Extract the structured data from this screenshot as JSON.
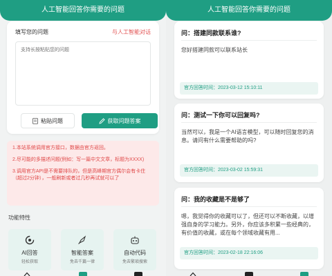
{
  "header": {
    "title": "人工智能回答你需要的问题"
  },
  "left": {
    "form": {
      "label": "填写您的问题",
      "link": "与人工智能对话",
      "placeholder": "支持长按粘贴您的问题",
      "paste_label": "粘贴问题",
      "get_answer_label": "获取问题答案"
    },
    "notices": [
      "1.本站系统调用官方接口，数据由官方返回。",
      "2.尽可能的多描述问题(例如：写一篇中文文章，标题为XXXX)",
      "3.调用官方API是不需要排队的，但是高峰期官方偶尔会有卡住（超过2分钟），一般刷新或者过几秒再试就可以了"
    ],
    "features": {
      "title": "功能特性",
      "items": [
        {
          "title": "AI回答",
          "subtitle": "轻松获取",
          "icon": "c-logo-icon"
        },
        {
          "title": "智能答案",
          "subtitle": "免去千篇一律",
          "icon": "rocket-icon"
        },
        {
          "title": "自动代码",
          "subtitle": "免去繁琐搜索",
          "icon": "robot-icon"
        }
      ]
    }
  },
  "right": {
    "answers": [
      {
        "question": "问：搭建同款联系谁?",
        "answer": "您好搭建同款可以联系站长",
        "time": "官方回答时间：2023-03-12 15:10:11"
      },
      {
        "question": "问：测试一下你可以回复吗?",
        "answer": "当然可以，我是一个AI语言模型，可以随时回复您的消息。请问有什么需要帮助的吗?",
        "time": "官方回答时间：2023-03-02 15:59:31"
      },
      {
        "question": "问：我的收藏是不是够了",
        "answer": "嗯，我觉得你的收藏可以了，但还可以不断收藏，以增强自身的学习能力。另外，你应该多积累一些经典的，有价值的收藏，或在每个领域收藏有用...",
        "time": "官方回答时间：2023-02-18 22:16:06"
      }
    ]
  },
  "colors": {
    "brand": "#1f9e83",
    "warning_text": "#e04848",
    "warning_bg": "#fde9e9"
  }
}
